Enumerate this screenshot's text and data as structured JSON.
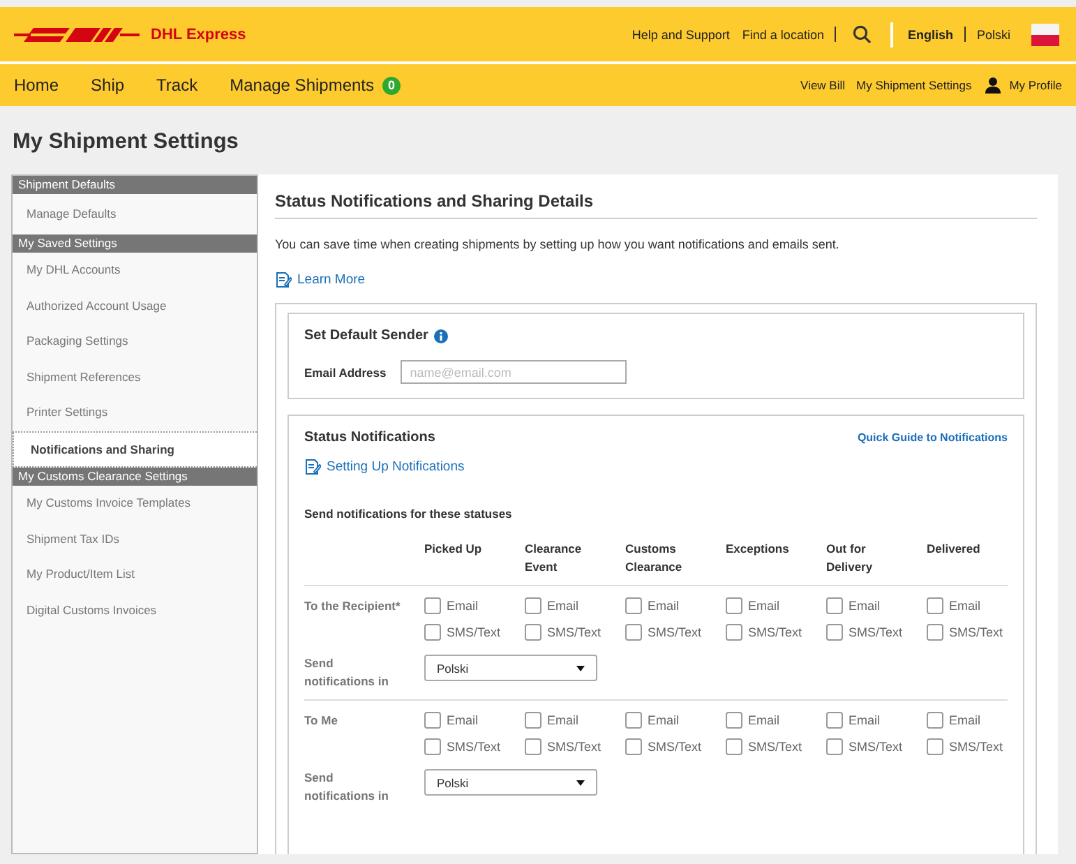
{
  "header": {
    "brand": "DHL Express",
    "links": [
      {
        "label": "Help and Support"
      },
      {
        "label": "Find a location"
      }
    ],
    "languages": [
      {
        "label": "English",
        "selected": true
      },
      {
        "label": "Polski",
        "selected": false
      }
    ]
  },
  "nav": {
    "items": [
      {
        "label": "Home"
      },
      {
        "label": "Ship"
      },
      {
        "label": "Track"
      },
      {
        "label": "Manage Shipments",
        "badge": "0"
      }
    ],
    "right_links": [
      {
        "label": "View Bill"
      },
      {
        "label": "My Shipment Settings"
      },
      {
        "label": "My Profile",
        "kind": "profile"
      }
    ]
  },
  "page_title": "My Shipment Settings",
  "sidebar": {
    "sections": [
      {
        "title": "Shipment Defaults",
        "items": [
          {
            "label": "Manage Defaults",
            "selected": false
          }
        ]
      },
      {
        "title": "My Saved Settings",
        "items": [
          {
            "label": "My DHL Accounts",
            "selected": false
          },
          {
            "label": "Authorized Account Usage",
            "selected": false
          },
          {
            "label": "Packaging Settings",
            "selected": false
          },
          {
            "label": "Shipment References",
            "selected": false
          },
          {
            "label": "Printer Settings",
            "selected": false
          },
          {
            "label": "Notifications and Sharing",
            "selected": true
          }
        ]
      },
      {
        "title": "My Customs Clearance Settings",
        "items": [
          {
            "label": "My Customs Invoice Templates",
            "selected": false
          },
          {
            "label": "Shipment Tax IDs",
            "selected": false
          },
          {
            "label": "My Product/Item List",
            "selected": false
          },
          {
            "label": "Digital Customs Invoices",
            "selected": false
          }
        ]
      }
    ]
  },
  "main": {
    "title": "Status Notifications and Sharing Details",
    "description": "You can save time when creating shipments by setting up how you want notifications and emails sent.",
    "learn_more": "Learn More",
    "default_sender": {
      "title": "Set Default Sender",
      "email_label": "Email Address",
      "email_placeholder": "name@email.com"
    },
    "status_notifications": {
      "title": "Status Notifications",
      "quick_guide": "Quick Guide to Notifications",
      "setup_link": "Setting Up Notifications",
      "subtitle": "Send notifications for these statuses",
      "statuses": [
        "Picked Up",
        "Clearance Event",
        "Customs Clearance",
        "Exceptions",
        "Out for Delivery",
        "Delivered"
      ],
      "groups": [
        {
          "label": "To the Recipient*",
          "language_label": "Send notifications in",
          "language": "Polski",
          "cells": [
            {
              "checks": [
                {
                  "label": "Email",
                  "checked": false
                },
                {
                  "label": "SMS/Text",
                  "checked": false
                }
              ]
            },
            {
              "checks": [
                {
                  "label": "Email",
                  "checked": false
                },
                {
                  "label": "SMS/Text",
                  "checked": false
                }
              ]
            },
            {
              "checks": [
                {
                  "label": "Email",
                  "checked": false
                },
                {
                  "label": "SMS/Text",
                  "checked": false
                }
              ]
            },
            {
              "checks": [
                {
                  "label": "Email",
                  "checked": false
                },
                {
                  "label": "SMS/Text",
                  "checked": false
                }
              ]
            },
            {
              "checks": [
                {
                  "label": "Email",
                  "checked": false
                },
                {
                  "label": "SMS/Text",
                  "checked": false
                }
              ]
            },
            {
              "checks": [
                {
                  "label": "Email",
                  "checked": false
                },
                {
                  "label": "SMS/Text",
                  "checked": false
                }
              ]
            }
          ]
        },
        {
          "label": "To Me",
          "language_label": "Send notifications in",
          "language": "Polski",
          "cells": [
            {
              "checks": [
                {
                  "label": "Email",
                  "checked": false
                },
                {
                  "label": "SMS/Text",
                  "checked": false
                }
              ]
            },
            {
              "checks": [
                {
                  "label": "Email",
                  "checked": false
                },
                {
                  "label": "SMS/Text",
                  "checked": false
                }
              ]
            },
            {
              "checks": [
                {
                  "label": "Email",
                  "checked": false
                },
                {
                  "label": "SMS/Text",
                  "checked": false
                }
              ]
            },
            {
              "checks": [
                {
                  "label": "Email",
                  "checked": false
                },
                {
                  "label": "SMS/Text",
                  "checked": false
                }
              ]
            },
            {
              "checks": [
                {
                  "label": "Email",
                  "checked": false
                },
                {
                  "label": "SMS/Text",
                  "checked": false
                }
              ]
            },
            {
              "checks": [
                {
                  "label": "Email",
                  "checked": false
                },
                {
                  "label": "SMS/Text",
                  "checked": false
                }
              ]
            }
          ]
        }
      ]
    }
  }
}
